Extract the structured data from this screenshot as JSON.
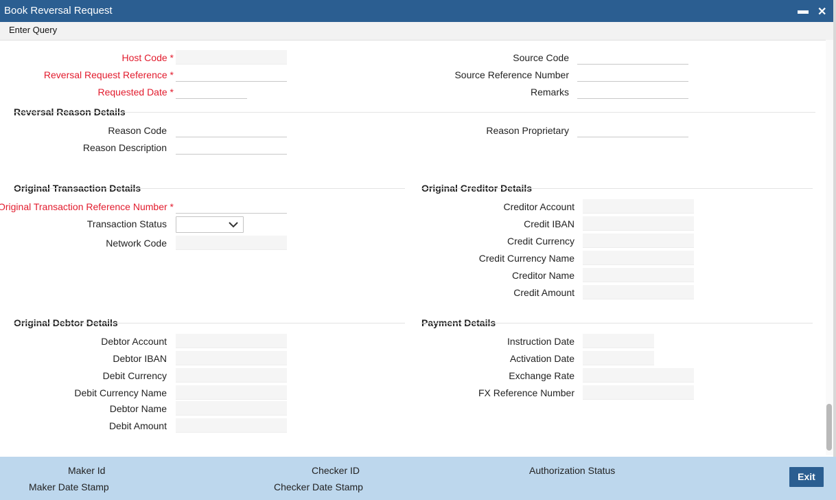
{
  "window": {
    "title": "Book Reversal Request",
    "minimize_label": "▬",
    "close_label": "✕"
  },
  "menu": {
    "enter_query": "Enter Query"
  },
  "header": {
    "host_code": {
      "label": "Host Code",
      "required_mark": "*",
      "value": ""
    },
    "reversal_request_reference": {
      "label": "Reversal Request Reference",
      "required_mark": "*",
      "value": ""
    },
    "requested_date": {
      "label": "Requested Date",
      "required_mark": "*",
      "value": ""
    },
    "source_code": {
      "label": "Source Code",
      "value": ""
    },
    "source_reference_number": {
      "label": "Source Reference Number",
      "value": ""
    },
    "remarks": {
      "label": "Remarks",
      "value": ""
    }
  },
  "reversal_reason": {
    "title": "Reversal Reason Details",
    "reason_code": {
      "label": "Reason Code",
      "value": ""
    },
    "reason_description": {
      "label": "Reason Description",
      "value": ""
    },
    "reason_proprietary": {
      "label": "Reason Proprietary",
      "value": ""
    }
  },
  "original_transaction": {
    "title": "Original Transaction Details",
    "reference_number": {
      "label": "Original Transaction Reference Number",
      "required_mark": "*",
      "value": ""
    },
    "transaction_status": {
      "label": "Transaction Status",
      "selected": ""
    },
    "network_code": {
      "label": "Network Code",
      "value": ""
    }
  },
  "original_creditor": {
    "title": "Original Creditor Details",
    "creditor_account": {
      "label": "Creditor Account",
      "value": ""
    },
    "credit_iban": {
      "label": "Credit IBAN",
      "value": ""
    },
    "credit_currency": {
      "label": "Credit Currency",
      "value": ""
    },
    "credit_currency_name": {
      "label": "Credit Currency Name",
      "value": ""
    },
    "creditor_name": {
      "label": "Creditor Name",
      "value": ""
    },
    "credit_amount": {
      "label": "Credit Amount",
      "value": ""
    }
  },
  "original_debtor": {
    "title": "Original Debtor Details",
    "debtor_account": {
      "label": "Debtor Account",
      "value": ""
    },
    "debtor_iban": {
      "label": "Debtor IBAN",
      "value": ""
    },
    "debit_currency": {
      "label": "Debit Currency",
      "value": ""
    },
    "debit_currency_name": {
      "label": "Debit Currency Name",
      "value": ""
    },
    "debtor_name": {
      "label": "Debtor Name",
      "value": ""
    },
    "debit_amount": {
      "label": "Debit Amount",
      "value": ""
    }
  },
  "payment_details": {
    "title": "Payment Details",
    "instruction_date": {
      "label": "Instruction Date",
      "value": ""
    },
    "activation_date": {
      "label": "Activation Date",
      "value": ""
    },
    "exchange_rate": {
      "label": "Exchange Rate",
      "value": ""
    },
    "fx_reference_number": {
      "label": "FX Reference Number",
      "value": ""
    }
  },
  "footer": {
    "maker_id": "Maker Id",
    "maker_date_stamp": "Maker Date Stamp",
    "checker_id": "Checker ID",
    "checker_date_stamp": "Checker Date Stamp",
    "authorization_status": "Authorization Status",
    "exit_label": "Exit"
  },
  "colors": {
    "titlebar": "#2b5e91",
    "required": "#e21b2d",
    "footer": "#bdd7ed",
    "exit_button": "#2b5e91"
  }
}
